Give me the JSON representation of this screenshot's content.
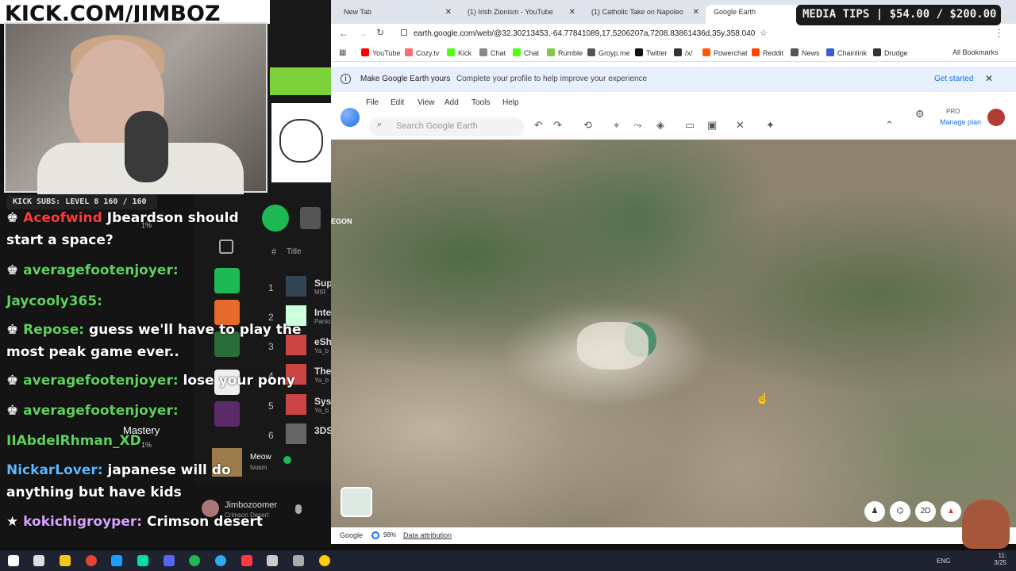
{
  "overlay": {
    "banner": "KICK.COM/JIMBOZ",
    "subs": "KICK SUBS: LEVEL 8 160 / 160",
    "media_tips": "MEDIA TIPS | $54.00 / $200.00",
    "music": {
      "header_hash": "#",
      "header_title": "Title",
      "tracks": [
        {
          "n": "1",
          "title": "Supe",
          "sub": "MIR"
        },
        {
          "n": "2",
          "title": "Inter",
          "sub": "Panlo"
        },
        {
          "n": "3",
          "title": "eSho",
          "sub": "Ya_b"
        },
        {
          "n": "4",
          "title": "Ther",
          "sub": "Ya_b"
        },
        {
          "n": "5",
          "title": "Syst",
          "sub": "Ya_b"
        },
        {
          "n": "6",
          "title": "3DS",
          "sub": ""
        }
      ],
      "now_playing_title": "Meow",
      "now_playing_artist": "Ivusm",
      "user_name": "Jimbozoomer",
      "user_game": "Crimson Desert"
    },
    "misc_labels": {
      "p1": "1%",
      "mastery": "Mastery",
      "p2": "1%"
    },
    "chat": [
      {
        "user": "Aceofwind",
        "msg": "Jbeardson should",
        "color": "r"
      },
      {
        "user": "",
        "msg": "start a space?",
        "color": "w"
      },
      {
        "user": "averagefootenjoyer:",
        "msg": "",
        "color": "u"
      },
      {
        "user": "Jaycooly365:",
        "msg": "",
        "color": "u"
      },
      {
        "user": "Repose:",
        "msg": "guess we'll have to play the",
        "color": "u"
      },
      {
        "user": "",
        "msg": "most peak game ever..",
        "color": "w"
      },
      {
        "user": "averagefootenjoyer:",
        "msg": "lose your pony",
        "color": "u"
      },
      {
        "user": "averagefootenjoyer:",
        "msg": "",
        "color": "u"
      },
      {
        "user": "IIAbdelRhman_XD",
        "msg": "",
        "color": "u"
      },
      {
        "user": "NickarLover:",
        "msg": "japanese will do",
        "color": "b"
      },
      {
        "user": "",
        "msg": "anything but have kids",
        "color": "w"
      },
      {
        "user": "kokichigroyper:",
        "msg": "Crimson desert",
        "color": "p"
      }
    ]
  },
  "browser": {
    "tabs": [
      {
        "label": "New Tab"
      },
      {
        "label": "(1) Irish Zionism - YouTube"
      },
      {
        "label": "(1) Catholic Take on Napoleo"
      },
      {
        "label": "Google Earth"
      }
    ],
    "url": "earth.google.com/web/@32.30213453,-64.77841089,17.5206207a,7208.83861436d,35y,358.0407...",
    "bookmarks": [
      "YouTube",
      "Cozy.tv",
      "Kick",
      "Chat",
      "Chat",
      "Rumble",
      "Groyp.me",
      "Twitter",
      "/x/",
      "Powerchat",
      "Reddit",
      "News",
      "Chainlink",
      "Drudge"
    ],
    "all_bookmarks": "All Bookmarks",
    "bookmark_colors": [
      "#ff0000",
      "#ff6b6b",
      "#53fc18",
      "#888888",
      "#53fc18",
      "#85c742",
      "#555555",
      "#111111",
      "#333333",
      "#ff5a00",
      "#ff4500",
      "#555555",
      "#375bd2",
      "#333333"
    ]
  },
  "earth": {
    "info_title": "Make Google Earth yours",
    "info_text": "Complete your profile to help improve your experience",
    "get_started": "Get started",
    "menu": [
      "File",
      "Edit",
      "View",
      "Add",
      "Tools",
      "Help"
    ],
    "search_placeholder": "Search Google Earth",
    "pro": "PRO",
    "manage_plan": "Manage plan",
    "map_label": "EGON",
    "footer_brand": "Google",
    "footer_pct": "98%",
    "data_attribution": "Data attribution",
    "btn_2d": "2D"
  },
  "taskbar": {
    "lang": "ENG",
    "time": "11:",
    "date": "3/25",
    "icon_colors": [
      "#ffffff",
      "#dddddd",
      "#f5c518",
      "#ea4335",
      "#1a9fff",
      "#00e1a0",
      "#5865f2",
      "#1db954",
      "#2aabee",
      "#ff3b3b",
      "#cccccc",
      "#ffcc00"
    ]
  }
}
